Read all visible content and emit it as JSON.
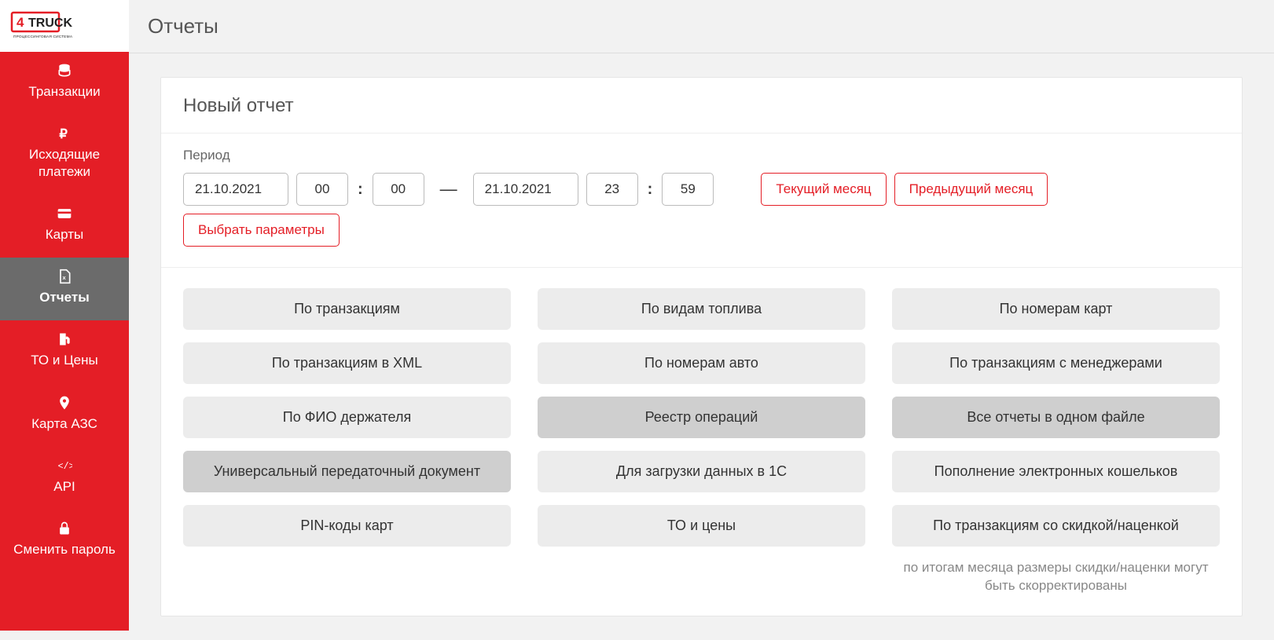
{
  "logo": {
    "brand": "TRUCK",
    "tagline": "ПРОЦЕССИНГОВАЯ СИСТЕМА"
  },
  "page_title": "Отчеты",
  "sidebar": {
    "items": [
      {
        "label": "Транзакции",
        "icon": "db",
        "name": "sidebar-item-transactions"
      },
      {
        "label": "Исходящие платежи",
        "icon": "ruble",
        "name": "sidebar-item-payments"
      },
      {
        "label": "Карты",
        "icon": "card",
        "name": "sidebar-item-cards"
      },
      {
        "label": "Отчеты",
        "icon": "file-x",
        "name": "sidebar-item-reports",
        "active": true
      },
      {
        "label": "ТО и Цены",
        "icon": "pump",
        "name": "sidebar-item-to-prices"
      },
      {
        "label": "Карта АЗС",
        "icon": "pin",
        "name": "sidebar-item-map"
      },
      {
        "label": "API",
        "icon": "code",
        "name": "sidebar-item-api"
      },
      {
        "label": "Сменить пароль",
        "icon": "lock",
        "name": "sidebar-item-change-password"
      }
    ]
  },
  "card": {
    "title": "Новый отчет",
    "period_label": "Период",
    "from_date": "21.10.2021",
    "from_hh": "00",
    "from_mm": "00",
    "to_date": "21.10.2021",
    "to_hh": "23",
    "to_mm": "59",
    "btn_current_month": "Текущий месяц",
    "btn_prev_month": "Предыдущий месяц",
    "btn_params": "Выбрать параметры"
  },
  "reports": [
    {
      "label": "По транзакциям",
      "dark": false
    },
    {
      "label": "По видам топлива",
      "dark": false
    },
    {
      "label": "По номерам карт",
      "dark": false
    },
    {
      "label": "По транзакциям в XML",
      "dark": false
    },
    {
      "label": "По номерам авто",
      "dark": false
    },
    {
      "label": "По транзакциям с менеджерами",
      "dark": false
    },
    {
      "label": "По ФИО держателя",
      "dark": false
    },
    {
      "label": "Реестр операций",
      "dark": true
    },
    {
      "label": "Все отчеты в одном файле",
      "dark": true
    },
    {
      "label": "Универсальный передаточный документ",
      "dark": true
    },
    {
      "label": "Для загрузки данных в 1С",
      "dark": false
    },
    {
      "label": "Пополнение электронных кошельков",
      "dark": false
    },
    {
      "label": "PIN-коды карт",
      "dark": false
    },
    {
      "label": "ТО и цены",
      "dark": false
    },
    {
      "label": "По транзакциям со скидкой/наценкой",
      "dark": false
    }
  ],
  "footnote": "по итогам месяца размеры скидки/наценки могут быть скорректированы"
}
